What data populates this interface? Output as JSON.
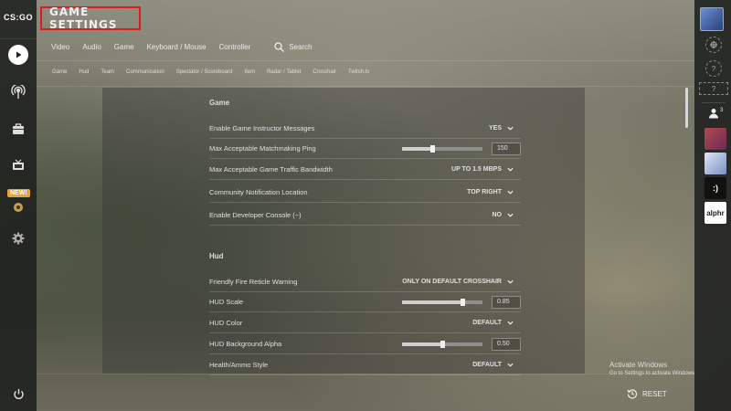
{
  "app": {
    "logo_text": "CS:GO",
    "title": "GAME SETTINGS"
  },
  "left_nav": {
    "new_badge": "NEW!"
  },
  "tabs": [
    "Video",
    "Audio",
    "Game",
    "Keyboard / Mouse",
    "Controller"
  ],
  "search_label": "Search",
  "subtabs": [
    "Game",
    "Hud",
    "Team",
    "Communication",
    "Spectator / Scoreboard",
    "Item",
    "Radar / Tablet",
    "Crosshair",
    "Twitch.tv"
  ],
  "sections": {
    "game": {
      "title": "Game",
      "rows": [
        {
          "label": "Enable Game Instructor Messages",
          "value": "YES"
        },
        {
          "label": "Max Acceptable Matchmaking Ping",
          "value": "150",
          "slider": 0.38
        },
        {
          "label": "Max Acceptable Game Traffic Bandwidth",
          "value": "UP TO 1.5 MBPS"
        },
        {
          "label": "Community Notification Location",
          "value": "TOP RIGHT"
        },
        {
          "label": "Enable Developer Console (~)",
          "value": "NO"
        }
      ]
    },
    "hud": {
      "title": "Hud",
      "rows": [
        {
          "label": "Friendly Fire Reticle Warning",
          "value": "ONLY ON DEFAULT CROSSHAIR"
        },
        {
          "label": "HUD Scale",
          "value": "0.85",
          "slider": 0.75
        },
        {
          "label": "HUD Color",
          "value": "DEFAULT"
        },
        {
          "label": "HUD Background Alpha",
          "value": "0.50",
          "slider": 0.5
        },
        {
          "label": "Health/Ammo Style",
          "value": "DEFAULT"
        }
      ]
    }
  },
  "right_bar": {
    "friends_count": "3",
    "help_label": "?",
    "avatar_text_smile": ":)",
    "avatar_text_alphr": "alphr"
  },
  "watermark": {
    "line1": "Activate Windows",
    "line2": "Go to Settings to activate Windows."
  },
  "reset_label": "RESET",
  "colors": {
    "title_border": "#d42020",
    "new_badge": "#e8a33a"
  }
}
